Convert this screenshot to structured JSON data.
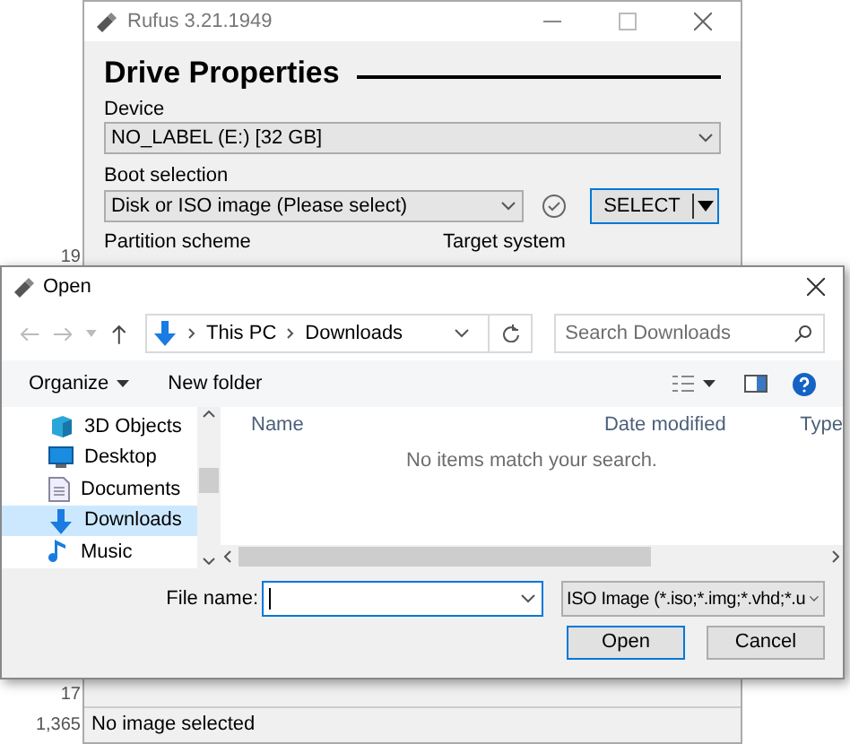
{
  "background": {
    "numbers": [
      "19",
      "17",
      "1,365"
    ]
  },
  "rufus": {
    "title": "Rufus 3.21.1949",
    "heading": "Drive Properties",
    "device": {
      "label": "Device",
      "value": "NO_LABEL (E:) [32 GB]"
    },
    "boot": {
      "label": "Boot selection",
      "value": "Disk or ISO image (Please select)",
      "button": "SELECT"
    },
    "partition_label": "Partition scheme",
    "target_label": "Target system",
    "status": "No image selected"
  },
  "dialog": {
    "title": "Open",
    "breadcrumb": [
      "This PC",
      "Downloads"
    ],
    "search": {
      "placeholder": "Search Downloads"
    },
    "toolbar": {
      "organize": "Organize",
      "new_folder": "New folder"
    },
    "nav": [
      {
        "label": "3D Objects",
        "kind": "objects",
        "selected": false
      },
      {
        "label": "Desktop",
        "kind": "desktop",
        "selected": false
      },
      {
        "label": "Documents",
        "kind": "documents",
        "selected": false
      },
      {
        "label": "Downloads",
        "kind": "downloads",
        "selected": true
      },
      {
        "label": "Music",
        "kind": "music",
        "selected": false
      }
    ],
    "columns": [
      "Name",
      "Date modified",
      "Type"
    ],
    "empty": "No items match your search.",
    "file_name_label": "File name:",
    "filter": "ISO Image (*.iso;*.img;*.vhd;*.u",
    "buttons": [
      "Open",
      "Cancel"
    ]
  }
}
